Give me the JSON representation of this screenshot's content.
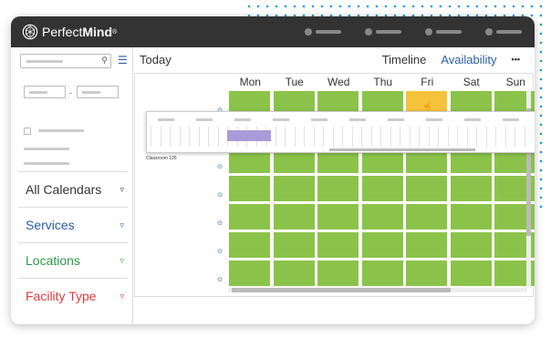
{
  "brand": {
    "name_light": "Perfect",
    "name_bold": "Mind",
    "mark": "®"
  },
  "toolbar": {
    "today": "Today",
    "timeline": "Timeline",
    "availability": "Availability",
    "more": "•••"
  },
  "filters": [
    {
      "label": "All Calendars",
      "color": "#333333"
    },
    {
      "label": "Services",
      "color": "#2a5da8"
    },
    {
      "label": "Locations",
      "color": "#2e9a47"
    },
    {
      "label": "Facility Type",
      "color": "#e03b3b"
    }
  ],
  "days": [
    "Mon",
    "Tue",
    "Wed",
    "Thu",
    "Fri",
    "Sat",
    "Sun"
  ],
  "room_label": "Classroom 126",
  "colors": {
    "available": "#8bc34a",
    "selected": "#f5c33a",
    "booked": "#a79bd9",
    "topbar": "#333333",
    "accent": "#2a5da8"
  },
  "selected_day": "Fri"
}
